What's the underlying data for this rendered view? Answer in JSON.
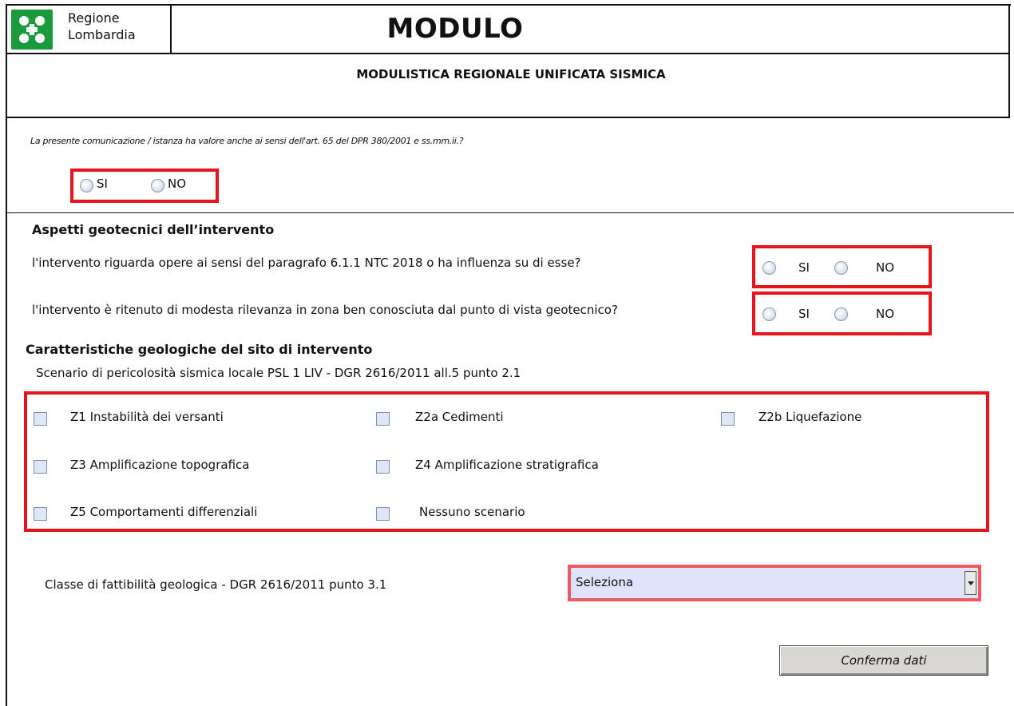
{
  "header": {
    "org_line1": "Regione",
    "org_line2": "Lombardia",
    "title": "MODULO",
    "subtitle": "MODULISTICA REGIONALE UNIFICATA SISMICA",
    "logo_color": "#1a9a3a"
  },
  "dpr_question": {
    "text": "La presente comunicazione / istanza ha valore anche ai sensi dell'art. 65 del DPR 380/2001 e ss.mm.ii.?",
    "yes_label": "SI",
    "no_label": "NO"
  },
  "geotechnical": {
    "title": "Aspetti geotecnici dell’intervento",
    "q1": {
      "text": "l'intervento riguarda opere ai sensi del paragrafo 6.1.1 NTC 2018  o ha influenza su di esse?",
      "yes_label": "SI",
      "no_label": "NO"
    },
    "q2": {
      "text": "l'intervento è ritenuto di modesta rilevanza in zona ben conosciuta dal punto di vista geotecnico?",
      "yes_label": "SI",
      "no_label": "NO"
    }
  },
  "geological": {
    "title": "Caratteristiche geologiche del sito di intervento",
    "scenario_text": "Scenario di pericolosità sismica locale PSL 1 LIV - DGR 2616/2011 all.5 punto 2.1",
    "checkboxes": [
      "Z1 Instabilità dei versanti",
      "Z2a Cedimenti",
      "Z2b Liquefazione",
      "Z3 Amplificazione topografica",
      "Z4 Amplificazione stratigrafica",
      "Z5 Comportamenti differenziali",
      "Nessuno scenario"
    ]
  },
  "feasibility": {
    "label": "Classe di fattibilità geologica - DGR 2616/2011 punto 3.1",
    "select_value": "Seleziona"
  },
  "confirm_label": "Conferma dati",
  "colors": {
    "highlight_red": "#e8141c",
    "select_bg": "#dfe4fb",
    "checkbox_bg": "#dfe6f7",
    "button_bg": "#d9d7d3"
  }
}
